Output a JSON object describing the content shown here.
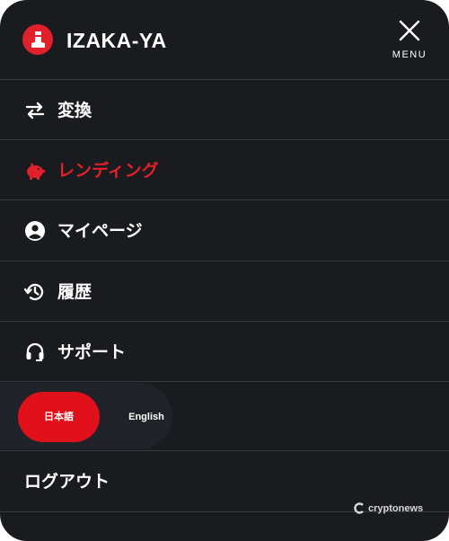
{
  "header": {
    "brand": "IZAKA-YA",
    "menu_label": "MENU",
    "menu_icon": "close-icon",
    "logo_icon": "izaka-ya-logo"
  },
  "colors": {
    "accent": "#e0202a",
    "background": "#1a1b1e",
    "divider": "#3a3b3f",
    "text": "#ffffff"
  },
  "menu": {
    "items": [
      {
        "label": "変換",
        "icon": "swap-arrows-icon",
        "active": false
      },
      {
        "label": "レンディング",
        "icon": "piggy-bank-icon",
        "active": true
      },
      {
        "label": "マイページ",
        "icon": "account-circle-icon",
        "active": false
      },
      {
        "label": "履歴",
        "icon": "history-icon",
        "active": false
      },
      {
        "label": "サポート",
        "icon": "headset-icon",
        "active": false
      }
    ]
  },
  "language": {
    "options": [
      "日本語",
      "English"
    ],
    "selected": "日本語"
  },
  "logout": {
    "label": "ログアウト"
  },
  "watermark": {
    "text": "cryptonews",
    "icon": "cryptonews-logo-icon"
  }
}
